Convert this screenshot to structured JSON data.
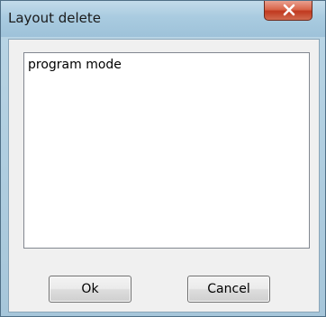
{
  "window": {
    "title": "Layout delete",
    "close_icon": "close-x-icon"
  },
  "list": {
    "items": [
      {
        "label": "program mode"
      }
    ]
  },
  "buttons": {
    "ok_label": "Ok",
    "cancel_label": "Cancel"
  },
  "colors": {
    "close_button": "#c0391f",
    "titlebar": "#a9cbe0",
    "client_background": "#f0f0f0"
  }
}
